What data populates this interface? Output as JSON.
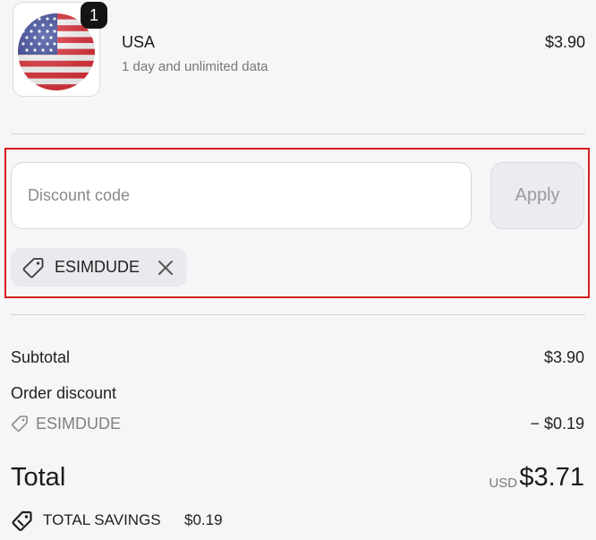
{
  "product": {
    "quantity": "1",
    "name": "USA",
    "description": "1 day and unlimited data",
    "price": "$3.90",
    "flag_icon": "us-flag-icon"
  },
  "discount": {
    "placeholder": "Discount code",
    "value": "",
    "apply_label": "Apply",
    "applied_code": "ESIMDUDE",
    "highlight_color": "#d81e1e"
  },
  "summary": {
    "subtotal_label": "Subtotal",
    "subtotal_value": "$3.90",
    "order_discount_label": "Order discount",
    "discount_code": "ESIMDUDE",
    "discount_value": "− $0.19",
    "total_label": "Total",
    "currency": "USD",
    "total_value": "$3.71",
    "savings_label": "TOTAL SAVINGS",
    "savings_value": "$0.19"
  }
}
